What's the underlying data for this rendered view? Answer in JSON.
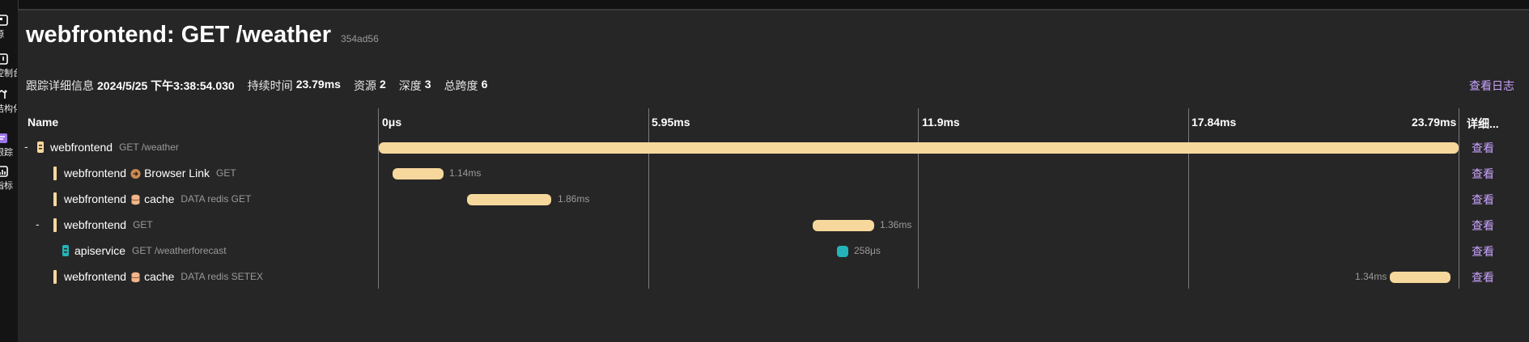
{
  "nav": {
    "items": [
      {
        "label": "源",
        "icon": "resources-icon"
      },
      {
        "label": "控制台",
        "icon": "console-icon"
      },
      {
        "label": "结构化",
        "icon": "structured-icon"
      },
      {
        "label": "跟踪",
        "icon": "traces-icon"
      },
      {
        "label": "指标",
        "icon": "metrics-icon"
      }
    ]
  },
  "header": {
    "title": "webfrontend: GET /weather",
    "trace_id": "354ad56"
  },
  "meta": {
    "trace_detail_label": "跟踪详细信息",
    "trace_detail_value": "2024/5/25 下午3:38:54.030",
    "duration_label": "持续时间",
    "duration_value": "23.79ms",
    "resources_label": "资源",
    "resources_value": "2",
    "depth_label": "深度",
    "depth_value": "3",
    "total_spans_label": "总跨度",
    "total_spans_value": "6"
  },
  "view_logs": "查看日志",
  "grid": {
    "name_header": "Name",
    "details_header": "详细...",
    "ticks": [
      "0μs",
      "5.95ms",
      "11.9ms",
      "17.84ms",
      "23.79ms"
    ]
  },
  "colors": {
    "webfrontend": "#f7d89c",
    "apiservice": "#24b3b8",
    "link": "#c9a4ff"
  },
  "spans": [
    {
      "toggle": "-",
      "service": "webfrontend",
      "icon": "",
      "operation": "",
      "description": "GET /weather",
      "duration": "",
      "view": "查看"
    },
    {
      "toggle": "",
      "service": "webfrontend",
      "icon": "arrow-circle-icon",
      "operation": "Browser Link",
      "description": "GET",
      "duration": "1.14ms",
      "view": "查看"
    },
    {
      "toggle": "",
      "service": "webfrontend",
      "icon": "database-icon",
      "operation": "cache",
      "description": "DATA redis GET",
      "duration": "1.86ms",
      "view": "查看"
    },
    {
      "toggle": "-",
      "service": "webfrontend",
      "icon": "",
      "operation": "",
      "description": "GET",
      "duration": "1.36ms",
      "view": "查看"
    },
    {
      "toggle": "",
      "service": "apiservice",
      "icon": "",
      "operation": "",
      "description": "GET /weatherforecast",
      "duration": "258μs",
      "view": "查看"
    },
    {
      "toggle": "",
      "service": "webfrontend",
      "icon": "database-icon",
      "operation": "cache",
      "description": "DATA redis SETEX",
      "duration": "1.34ms",
      "view": "查看"
    }
  ]
}
